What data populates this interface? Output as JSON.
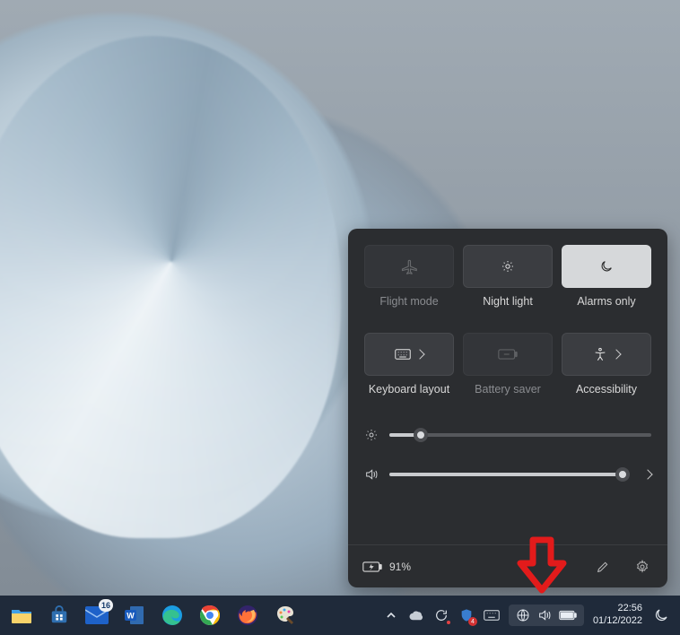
{
  "quick_settings": {
    "tiles": [
      {
        "id": "flight-mode",
        "label": "Flight mode",
        "active": false,
        "disabled": true,
        "has_chevron": false
      },
      {
        "id": "night-light",
        "label": "Night light",
        "active": false,
        "disabled": false,
        "has_chevron": false
      },
      {
        "id": "alarms-only",
        "label": "Alarms only",
        "active": true,
        "disabled": false,
        "has_chevron": false
      },
      {
        "id": "keyboard-layout",
        "label": "Keyboard layout",
        "active": false,
        "disabled": false,
        "has_chevron": true
      },
      {
        "id": "battery-saver",
        "label": "Battery saver",
        "active": false,
        "disabled": true,
        "has_chevron": false
      },
      {
        "id": "accessibility",
        "label": "Accessibility",
        "active": false,
        "disabled": false,
        "has_chevron": true
      }
    ],
    "brightness_percent": 12,
    "volume_percent": 97,
    "battery_text": "91%"
  },
  "taskbar": {
    "mail_badge": "16",
    "updates_badge": "4",
    "time": "22:56",
    "date": "01/12/2022"
  },
  "annotation": {
    "arrow_color": "#e21b1b"
  }
}
